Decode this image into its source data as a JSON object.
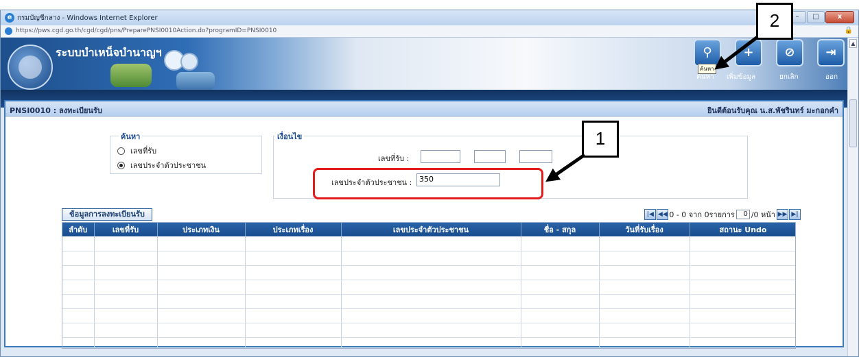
{
  "window": {
    "title": "กรมบัญชีกลาง - Windows Internet Explorer",
    "url": "https://pws.cgd.go.th/cgd/cgd/pns/PreparePNSI0010Action.do?programID=PNSI0010",
    "min_glyph": "–",
    "max_glyph": "□",
    "close_glyph": "x"
  },
  "banner": {
    "app_title": "ระบบบำเหน็จบำนาญฯ"
  },
  "toolbar": {
    "search_label": "ค้นหา",
    "search_tooltip": "ค้นหา",
    "add_label": "เพิ่มข้อมูล",
    "cancel_label": "ยกเลิก",
    "exit_label": "ออก",
    "search_glyph": "⚲",
    "add_glyph": "+",
    "cancel_glyph": "⊘",
    "exit_glyph": "⇥"
  },
  "page": {
    "code_title": "PNSI0010 : ลงทะเบียนรับ",
    "welcome": "ยินดีต้อนรับคุณ น.ส.พัชรินทร์ มะกอกคำ"
  },
  "search": {
    "legend": "ค้นหา",
    "option_receipt_no": "เลขที่รับ",
    "option_citizen_id": "เลขประจำตัวประชาชน",
    "selected": "citizen_id"
  },
  "condition": {
    "legend": "เงื่อนไข",
    "receipt_no_label": "เลขที่รับ :",
    "citizen_id_label": "เลขประจำตัวประชาชน :",
    "citizen_id_value": "350"
  },
  "results": {
    "section_label": "ข้อมูลการลงทะเบียนรับ",
    "pager": {
      "range_text": "0 - 0 จาก 0รายการ",
      "page_value": "0",
      "page_total": "/0 หน้า",
      "first_glyph": "|◀",
      "prev_glyph": "◀◀",
      "next_glyph": "▶▶",
      "last_glyph": "▶|"
    },
    "columns": [
      "ลำดับ",
      "เลขที่รับ",
      "ประเภทเงิน",
      "ประเภทเรื่อง",
      "เลขประจำตัวประชาชน",
      "ชื่อ - สกุล",
      "วันที่รับเรื่อง",
      "สถานะ Undo"
    ]
  },
  "annotations": {
    "step1": "1",
    "step2": "2"
  },
  "colors": {
    "accent": "#1f4f96",
    "highlight": "#e21b1b"
  }
}
